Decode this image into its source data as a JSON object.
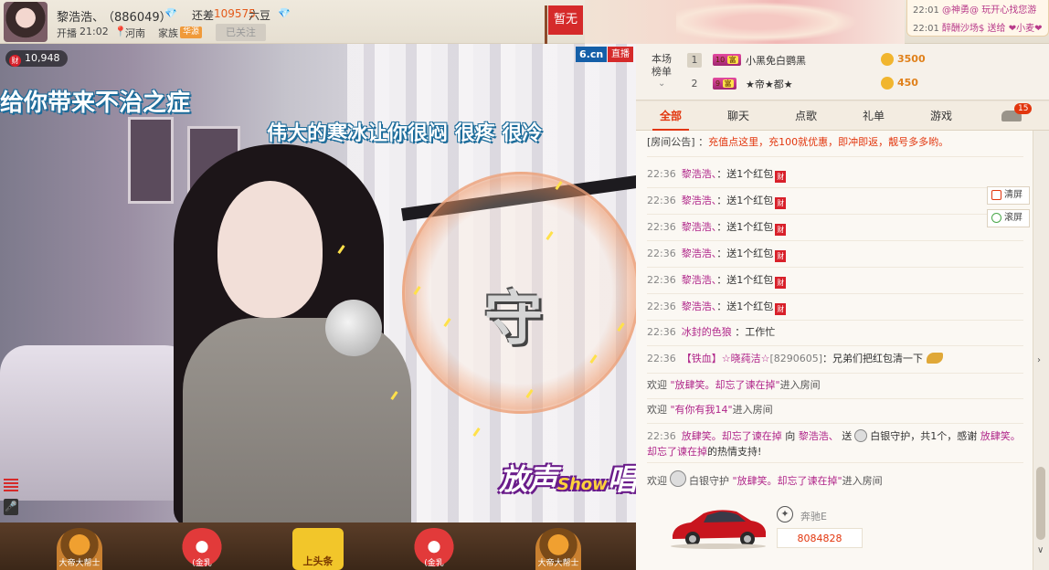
{
  "header": {
    "streamer_name": "黎浩浩、",
    "streamer_id": "（886049）",
    "gap_label": "还差",
    "gap_value": "109575",
    "gap_unit": "六豆",
    "start_label": "开播",
    "start_time": "21:02",
    "location": "河南",
    "family_label": "家族",
    "family_badge": "华源",
    "follow_label": "已关注",
    "pause_label": "暂无"
  },
  "ticker": [
    {
      "time": "22:01",
      "text": "@神勇@ 玩开心找您游"
    },
    {
      "time": "22:01",
      "text": "醉酬沙场$ 送给 ❤小麦❤"
    }
  ],
  "video": {
    "wealth_count": "10,948",
    "rich_icon": "财",
    "site_badge": "6.cn",
    "live_badge": "直播",
    "lyric_line_1": "给你带来不治之症",
    "lyric_line_2": "伟大的寒冰让你很闷  很疼  很冷",
    "orb_char": "守",
    "show_logo_main": "放声",
    "show_logo_accent": "Show",
    "show_logo_end": "唱",
    "mic_icon": "🎤"
  },
  "bottombar": {
    "items": [
      {
        "kind": "tiger",
        "label": "大帝大帮士"
      },
      {
        "kind": "red",
        "label": "(金乳"
      },
      {
        "kind": "star",
        "label": "上头条"
      },
      {
        "kind": "red",
        "label": "(金乳"
      },
      {
        "kind": "tiger",
        "label": "大帝大帮士"
      }
    ]
  },
  "ranking": {
    "label": "本场榜单",
    "chevron": "⌄",
    "rows": [
      {
        "rank": "1",
        "level": "10",
        "level_tag": "富",
        "name": "小黑免白鹦黑",
        "value": "3500"
      },
      {
        "rank": "2",
        "level": "9",
        "level_tag": "富",
        "name": "★帝★都★",
        "value": "450"
      }
    ]
  },
  "tabs": {
    "items": [
      "全部",
      "聊天",
      "点歌",
      "礼单",
      "游戏"
    ],
    "active": 0,
    "car_badge": "15"
  },
  "chat": {
    "notice_label": "[房间公告] ：",
    "notice_text": "充值点这里，充100就优惠，即冲即返，靓号多多哟。",
    "messages": [
      {
        "time": "22:36",
        "user": "黎浩浩、",
        "text": "送1个红包"
      },
      {
        "time": "22:36",
        "user": "黎浩浩、",
        "text": "送1个红包"
      },
      {
        "time": "22:36",
        "user": "黎浩浩、",
        "text": "送1个红包"
      },
      {
        "time": "22:36",
        "user": "黎浩浩、",
        "text": "送1个红包"
      },
      {
        "time": "22:36",
        "user": "黎浩浩、",
        "text": "送1个红包"
      },
      {
        "time": "22:36",
        "user": "黎浩浩、",
        "text": "送1个红包"
      }
    ],
    "msg_7": {
      "time": "22:36",
      "user": "冰封的色狼",
      "text": "：工作忙"
    },
    "msg_8": {
      "time": "22:36",
      "user": "【铁血】☆晓莼洁☆",
      "id": "[8290605]",
      "text": "：兄弟们把红包清一下"
    },
    "welcome_1": {
      "prefix": "欢迎",
      "name": "\"放肆笑。却忘了谏在掉\"",
      "suffix": "进入房间"
    },
    "welcome_2": {
      "prefix": "欢迎",
      "name": "\"有你有我14\"",
      "suffix": "进入房间"
    },
    "guard_msg": {
      "time": "22:36",
      "name1": "放肆笑。却忘了谏在掉",
      "mid1": "向",
      "name2": "黎浩浩、",
      "mid2": "送",
      "guard": "白银守护，共1个，感谢",
      "name3": "放肆笑。却忘了谏在掉",
      "end": "的热情支持!"
    },
    "welcome_3": {
      "prefix": "欢迎",
      "guard": "白银守护",
      "name": "\"放肆笑。却忘了谏在掉\"",
      "suffix": "进入房间"
    },
    "rich_tag": "财"
  },
  "side_buttons": {
    "clear": "清屏",
    "scroll": "滚屏"
  },
  "car": {
    "name": "奔驰E",
    "price": "8084828",
    "logo": "✦",
    "color": "#c8151e"
  },
  "scroll": {
    "down": "∨",
    "side": "›"
  }
}
